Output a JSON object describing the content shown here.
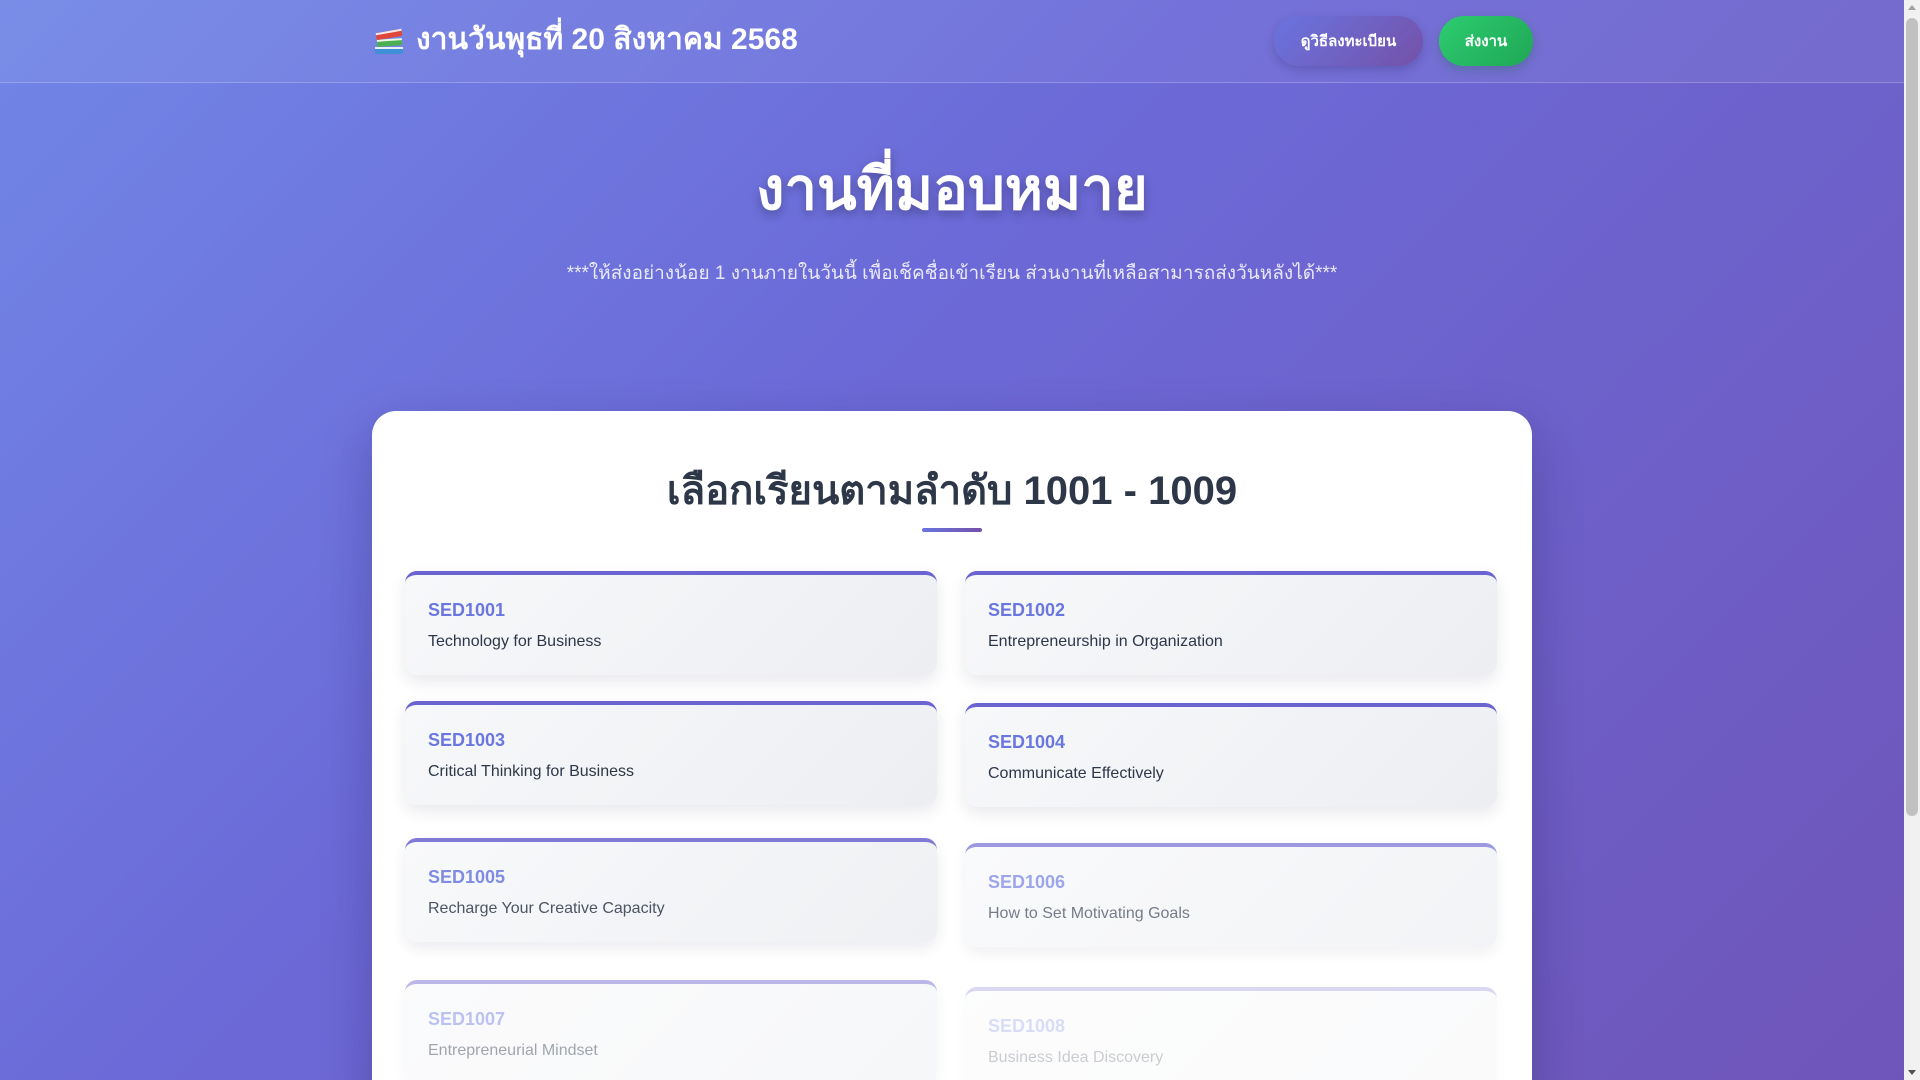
{
  "header": {
    "title": "งานวันพุธที่ 20 สิงหาคม 2568",
    "brand_icon": "books-icon",
    "register_button": "ดูวิธีลงทะเบียน",
    "submit_button": "ส่งงาน"
  },
  "hero": {
    "title": "งานที่มอบหมาย",
    "note": "***ให้ส่งอย่างน้อย 1 งานภายในวันนี้ เพื่อเช็คชื่อเข้าเรียน ส่วนงานที่เหลือสามารถส่งวันหลังได้***"
  },
  "panel": {
    "title": "เลือกเรียนตามลำดับ 1001 - 1009",
    "courses": [
      {
        "code": "SED1001",
        "name": "Technology for Business"
      },
      {
        "code": "SED1002",
        "name": "Entrepreneurship in Organization"
      },
      {
        "code": "SED1003",
        "name": "Critical Thinking for Business"
      },
      {
        "code": "SED1004",
        "name": "Communicate Effectively"
      },
      {
        "code": "SED1005",
        "name": "Recharge Your Creative Capacity"
      },
      {
        "code": "SED1006",
        "name": "How to Set Motivating Goals"
      },
      {
        "code": "SED1007",
        "name": "Entrepreneurial Mindset"
      },
      {
        "code": "SED1008",
        "name": "Business Idea Discovery"
      }
    ]
  },
  "colors": {
    "accent": "#6b77e0",
    "submit_green": "#2dcc70",
    "background_start": "#7186e6",
    "background_end": "#6f55b9"
  }
}
